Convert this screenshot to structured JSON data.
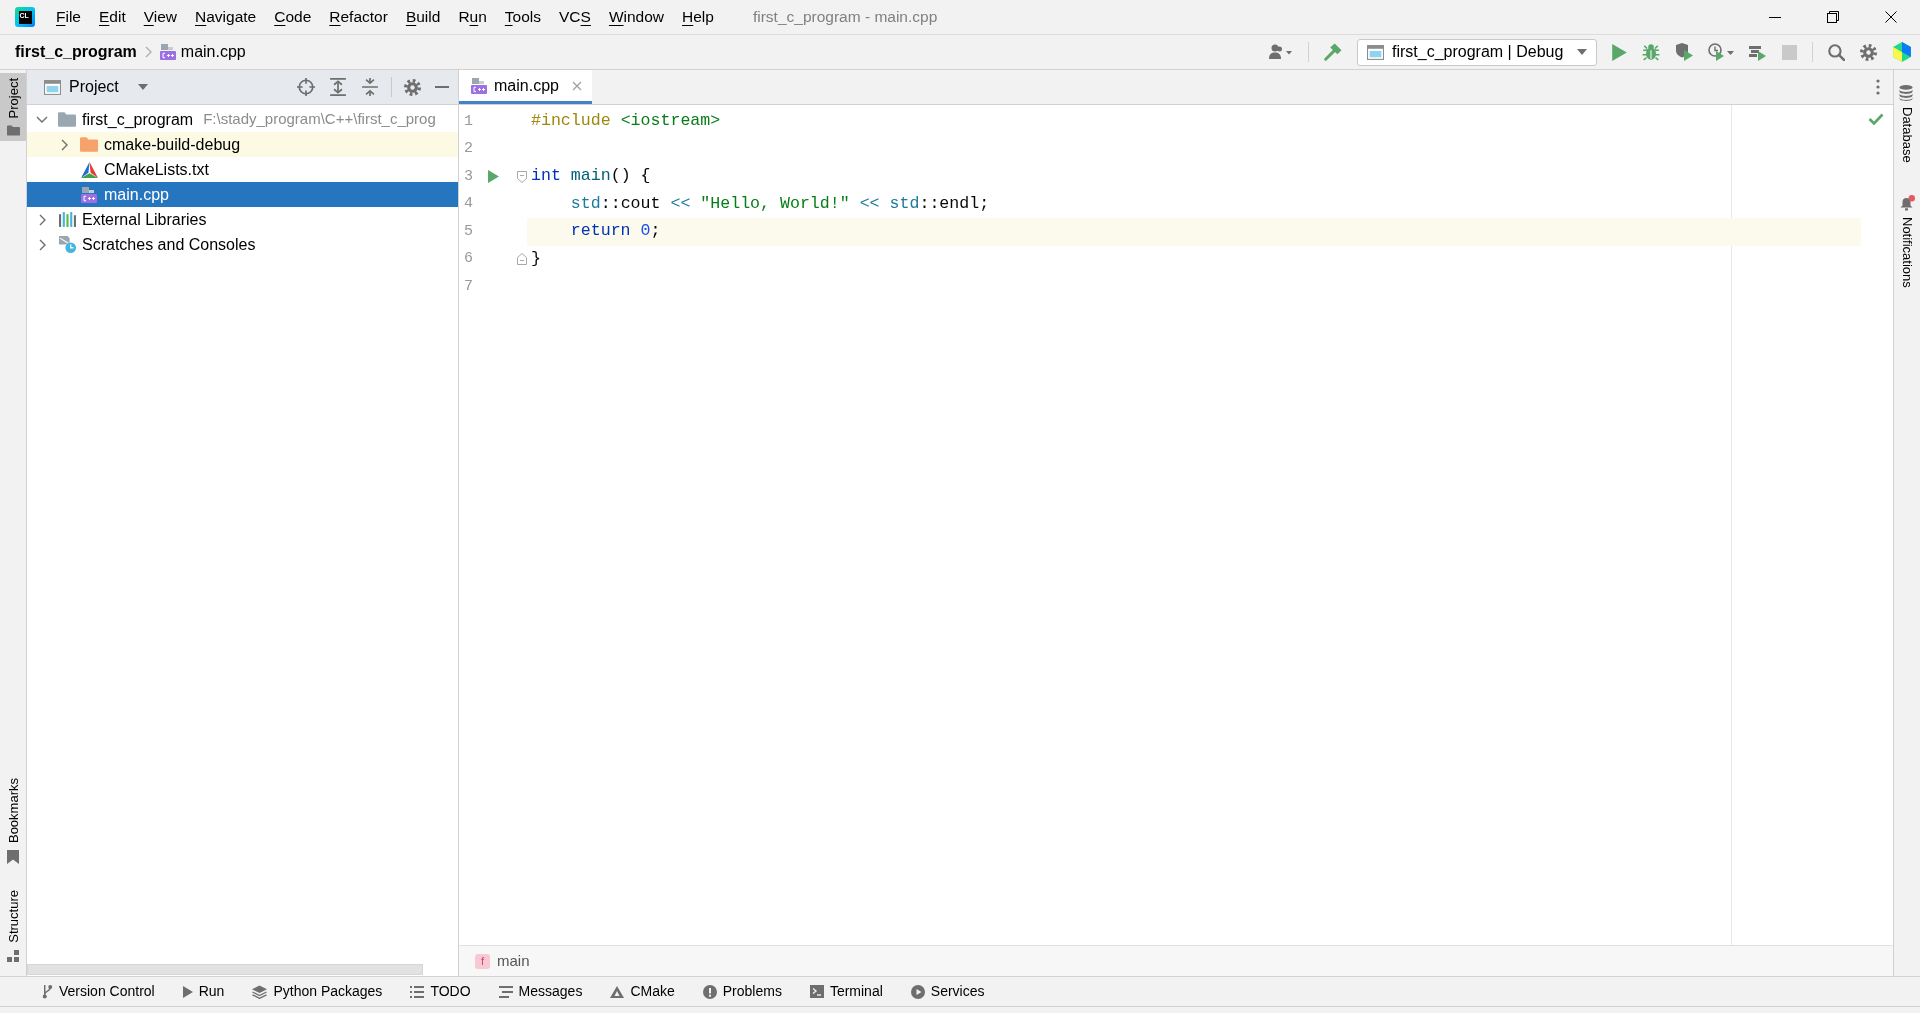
{
  "window": {
    "logo": "CL",
    "title": "first_c_program - main.cpp"
  },
  "menu": [
    {
      "key": "F",
      "after": "ile"
    },
    {
      "key": "E",
      "after": "dit"
    },
    {
      "key": "V",
      "after": "iew"
    },
    {
      "key": "N",
      "after": "avigate"
    },
    {
      "key": "C",
      "after": "ode"
    },
    {
      "key": "R",
      "after": "efactor"
    },
    {
      "key": "B",
      "after": "uild"
    },
    {
      "before": "R",
      "key": "u",
      "after": "n"
    },
    {
      "key": "T",
      "after": "ools"
    },
    {
      "before": "VC",
      "key": "S"
    },
    {
      "key": "W",
      "after": "indow"
    },
    {
      "key": "H",
      "after": "elp"
    }
  ],
  "breadcrumbs": [
    {
      "label": "first_c_program",
      "kind": "project"
    },
    {
      "label": "main.cpp",
      "kind": "cpp"
    }
  ],
  "toolbar": [
    {
      "kind": "account",
      "disabled": false
    },
    {
      "kind": "build",
      "disabled": false
    },
    {
      "kind": "run_config",
      "label": "first_c_program | Debug",
      "disabled": false
    },
    {
      "kind": "run",
      "disabled": false
    },
    {
      "kind": "debug",
      "disabled": false
    },
    {
      "kind": "coverage",
      "disabled": false
    },
    {
      "kind": "profile",
      "disabled": false
    },
    {
      "kind": "attach",
      "disabled": false
    },
    {
      "kind": "stop",
      "disabled": true
    },
    {
      "kind": "search",
      "disabled": false
    },
    {
      "kind": "settings",
      "disabled": false
    },
    {
      "kind": "toolbox",
      "disabled": false
    }
  ],
  "left_stripe": {
    "top": [
      {
        "label": "Project",
        "kind": "project",
        "selected": true
      }
    ],
    "bottom": [
      {
        "label": "Bookmarks",
        "kind": "bookmarks",
        "selected": false
      },
      {
        "label": "Structure",
        "kind": "structure",
        "selected": false
      }
    ]
  },
  "project_panel": {
    "title": "Project",
    "tree": [
      {
        "label": "first_c_program",
        "kind": "project_folder",
        "path": "F:\\stady_program\\C++\\first_c_prog",
        "expanded": true,
        "selected": false,
        "children": [
          {
            "label": "cmake-build-debug",
            "kind": "excluded_folder",
            "expanded": false,
            "selected": false
          },
          {
            "label": "CMakeLists.txt",
            "kind": "cmake",
            "selected": false
          },
          {
            "label": "main.cpp",
            "kind": "cpp",
            "selected": true
          }
        ]
      },
      {
        "label": "External Libraries",
        "kind": "libraries",
        "expanded": false,
        "selected": false
      },
      {
        "label": "Scratches and Consoles",
        "kind": "scratches",
        "expanded": false,
        "selected": false
      }
    ]
  },
  "editor": {
    "tabs": [
      {
        "label": "main.cpp",
        "selected": true
      }
    ],
    "lines": [
      {
        "number": "1",
        "current": false,
        "runnable": false,
        "fold_start": false,
        "fold_end": false,
        "tokens": [
          {
            "text": "#include",
            "kind": "directive"
          },
          {
            "text": " <iostream>",
            "kind": "header"
          }
        ]
      },
      {
        "number": "2",
        "current": false,
        "runnable": false,
        "fold_start": false,
        "fold_end": false
      },
      {
        "number": "3",
        "current": false,
        "runnable": true,
        "fold_start": true,
        "fold_end": false,
        "tokens": [
          {
            "text": "int",
            "kind": "keyword"
          },
          {
            "text": " main",
            "kind": "function"
          },
          {
            "text": "() {",
            "kind": "plain"
          }
        ]
      },
      {
        "number": "4",
        "current": false,
        "runnable": false,
        "fold_start": false,
        "fold_end": false,
        "tokens": [
          {
            "text": "    std",
            "kind": "namespace"
          },
          {
            "text": "::cout ",
            "kind": "plain"
          },
          {
            "text": "<<",
            "kind": "operator"
          },
          {
            "text": " \"Hello, World!\" ",
            "kind": "string"
          },
          {
            "text": "<<",
            "kind": "operator"
          },
          {
            "text": " std",
            "kind": "namespace"
          },
          {
            "text": "::endl;",
            "kind": "plain"
          }
        ]
      },
      {
        "number": "5",
        "current": true,
        "runnable": false,
        "fold_start": false,
        "fold_end": false,
        "tokens": [
          {
            "text": "    return",
            "kind": "keyword"
          },
          {
            "text": " 0",
            "kind": "number"
          },
          {
            "text": ";",
            "kind": "plain"
          }
        ]
      },
      {
        "number": "6",
        "current": false,
        "runnable": false,
        "fold_start": false,
        "fold_end": true,
        "tokens": [
          {
            "text": "}",
            "kind": "plain"
          }
        ]
      },
      {
        "number": "7",
        "current": false,
        "runnable": false,
        "fold_start": false,
        "fold_end": false
      }
    ],
    "breadcrumb": {
      "symbol": "f",
      "label": "main"
    }
  },
  "right_stripe": [
    {
      "label": "Database",
      "kind": "database",
      "badge": false
    },
    {
      "label": "Notifications",
      "kind": "notifications",
      "badge": true
    }
  ],
  "bottom_bar": [
    {
      "label": "Version Control",
      "kind": "vcs"
    },
    {
      "label": "Run",
      "kind": "run"
    },
    {
      "label": "Python Packages",
      "kind": "packages"
    },
    {
      "label": "TODO",
      "kind": "todo"
    },
    {
      "label": "Messages",
      "kind": "messages"
    },
    {
      "label": "CMake",
      "kind": "cmake"
    },
    {
      "label": "Problems",
      "kind": "problems"
    },
    {
      "label": "Terminal",
      "kind": "terminal"
    },
    {
      "label": "Services",
      "kind": "services"
    }
  ]
}
